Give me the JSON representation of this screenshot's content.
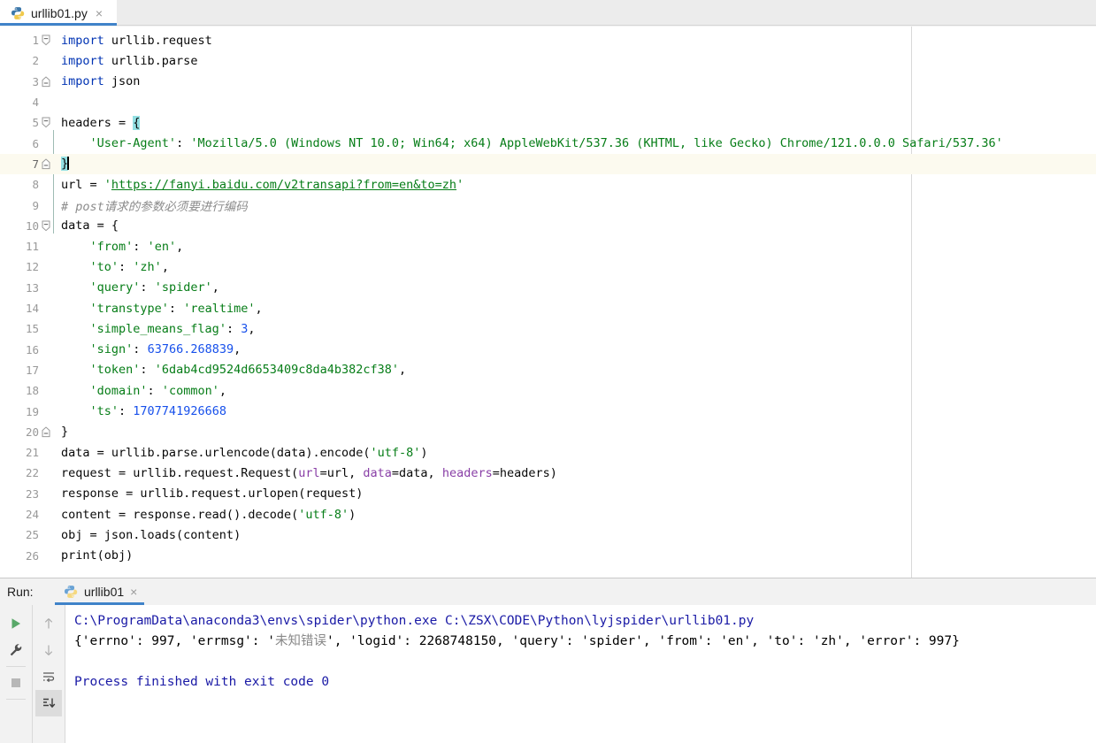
{
  "editor_tab": {
    "filename": "urllib01.py",
    "icon": "python-file-icon",
    "close_icon": "×",
    "accent_color": "#4083c9"
  },
  "code": {
    "language": "python",
    "current_line": 7,
    "lines": [
      {
        "n": 1,
        "fold": "start",
        "indent": false,
        "tokens": [
          {
            "t": "import",
            "c": "kw"
          },
          {
            "t": " urllib.request",
            "c": "plain"
          }
        ]
      },
      {
        "n": 2,
        "fold": "none",
        "indent": false,
        "tokens": [
          {
            "t": "import",
            "c": "kw"
          },
          {
            "t": " urllib.parse",
            "c": "plain"
          }
        ]
      },
      {
        "n": 3,
        "fold": "end",
        "indent": false,
        "tokens": [
          {
            "t": "import",
            "c": "kw"
          },
          {
            "t": " json",
            "c": "plain"
          }
        ]
      },
      {
        "n": 4,
        "fold": "none",
        "indent": false,
        "tokens": []
      },
      {
        "n": 5,
        "fold": "start",
        "indent": true,
        "tokens": [
          {
            "t": "headers = ",
            "c": "plain"
          },
          {
            "t": "{",
            "c": "brace-hl"
          }
        ]
      },
      {
        "n": 6,
        "fold": "none",
        "indent": true,
        "tokens": [
          {
            "t": "    ",
            "c": "plain"
          },
          {
            "t": "'User-Agent'",
            "c": "str"
          },
          {
            "t": ": ",
            "c": "plain"
          },
          {
            "t": "'Mozilla/5.0 (Windows NT 10.0; Win64; x64) AppleWebKit/537.36 (KHTML, like Gecko) Chrome/121.0.0.0 Safari/537.36'",
            "c": "str"
          }
        ]
      },
      {
        "n": 7,
        "fold": "end",
        "indent": true,
        "tokens": [
          {
            "t": "}",
            "c": "brace-hl"
          },
          {
            "t": "CARET",
            "c": "caret"
          }
        ]
      },
      {
        "n": 8,
        "fold": "none",
        "indent": false,
        "tokens": [
          {
            "t": "url = ",
            "c": "plain"
          },
          {
            "t": "'",
            "c": "str"
          },
          {
            "t": "https://fanyi.baidu.com/v2transapi?from=en&to=zh",
            "c": "url-link"
          },
          {
            "t": "'",
            "c": "str"
          }
        ]
      },
      {
        "n": 9,
        "fold": "none",
        "indent": false,
        "tokens": [
          {
            "t": "# post请求的参数必须要进行编码",
            "c": "cmt"
          }
        ]
      },
      {
        "n": 10,
        "fold": "start",
        "indent": false,
        "tokens": [
          {
            "t": "data = {",
            "c": "plain"
          }
        ]
      },
      {
        "n": 11,
        "fold": "none",
        "indent": false,
        "tokens": [
          {
            "t": "    ",
            "c": "plain"
          },
          {
            "t": "'from'",
            "c": "str"
          },
          {
            "t": ": ",
            "c": "plain"
          },
          {
            "t": "'en'",
            "c": "str"
          },
          {
            "t": ",",
            "c": "plain"
          }
        ]
      },
      {
        "n": 12,
        "fold": "none",
        "indent": false,
        "tokens": [
          {
            "t": "    ",
            "c": "plain"
          },
          {
            "t": "'to'",
            "c": "str"
          },
          {
            "t": ": ",
            "c": "plain"
          },
          {
            "t": "'zh'",
            "c": "str"
          },
          {
            "t": ",",
            "c": "plain"
          }
        ]
      },
      {
        "n": 13,
        "fold": "none",
        "indent": false,
        "tokens": [
          {
            "t": "    ",
            "c": "plain"
          },
          {
            "t": "'query'",
            "c": "str"
          },
          {
            "t": ": ",
            "c": "plain"
          },
          {
            "t": "'spider'",
            "c": "str"
          },
          {
            "t": ",",
            "c": "plain"
          }
        ]
      },
      {
        "n": 14,
        "fold": "none",
        "indent": false,
        "tokens": [
          {
            "t": "    ",
            "c": "plain"
          },
          {
            "t": "'transtype'",
            "c": "str"
          },
          {
            "t": ": ",
            "c": "plain"
          },
          {
            "t": "'realtime'",
            "c": "str"
          },
          {
            "t": ",",
            "c": "plain"
          }
        ]
      },
      {
        "n": 15,
        "fold": "none",
        "indent": false,
        "tokens": [
          {
            "t": "    ",
            "c": "plain"
          },
          {
            "t": "'simple_means_flag'",
            "c": "str"
          },
          {
            "t": ": ",
            "c": "plain"
          },
          {
            "t": "3",
            "c": "num"
          },
          {
            "t": ",",
            "c": "plain"
          }
        ]
      },
      {
        "n": 16,
        "fold": "none",
        "indent": false,
        "tokens": [
          {
            "t": "    ",
            "c": "plain"
          },
          {
            "t": "'sign'",
            "c": "str"
          },
          {
            "t": ": ",
            "c": "plain"
          },
          {
            "t": "63766.268839",
            "c": "num"
          },
          {
            "t": ",",
            "c": "plain"
          }
        ]
      },
      {
        "n": 17,
        "fold": "none",
        "indent": false,
        "tokens": [
          {
            "t": "    ",
            "c": "plain"
          },
          {
            "t": "'token'",
            "c": "str"
          },
          {
            "t": ": ",
            "c": "plain"
          },
          {
            "t": "'6dab4cd9524d6653409c8da4b382cf38'",
            "c": "str"
          },
          {
            "t": ",",
            "c": "plain"
          }
        ]
      },
      {
        "n": 18,
        "fold": "none",
        "indent": false,
        "tokens": [
          {
            "t": "    ",
            "c": "plain"
          },
          {
            "t": "'domain'",
            "c": "str"
          },
          {
            "t": ": ",
            "c": "plain"
          },
          {
            "t": "'common'",
            "c": "str"
          },
          {
            "t": ",",
            "c": "plain"
          }
        ]
      },
      {
        "n": 19,
        "fold": "none",
        "indent": false,
        "tokens": [
          {
            "t": "    ",
            "c": "plain"
          },
          {
            "t": "'ts'",
            "c": "str"
          },
          {
            "t": ": ",
            "c": "plain"
          },
          {
            "t": "1707741926668",
            "c": "num"
          }
        ]
      },
      {
        "n": 20,
        "fold": "end",
        "indent": false,
        "tokens": [
          {
            "t": "}",
            "c": "plain"
          }
        ]
      },
      {
        "n": 21,
        "fold": "none",
        "indent": false,
        "tokens": [
          {
            "t": "data = urllib.parse.urlencode(data).encode(",
            "c": "plain"
          },
          {
            "t": "'utf-8'",
            "c": "str"
          },
          {
            "t": ")",
            "c": "plain"
          }
        ]
      },
      {
        "n": 22,
        "fold": "none",
        "indent": false,
        "tokens": [
          {
            "t": "request = urllib.request.Request(",
            "c": "plain"
          },
          {
            "t": "url",
            "c": "kwarg"
          },
          {
            "t": "=url, ",
            "c": "plain"
          },
          {
            "t": "data",
            "c": "kwarg"
          },
          {
            "t": "=data, ",
            "c": "plain"
          },
          {
            "t": "headers",
            "c": "kwarg"
          },
          {
            "t": "=headers)",
            "c": "plain"
          }
        ]
      },
      {
        "n": 23,
        "fold": "none",
        "indent": false,
        "tokens": [
          {
            "t": "response = urllib.request.urlopen(request)",
            "c": "plain"
          }
        ]
      },
      {
        "n": 24,
        "fold": "none",
        "indent": false,
        "tokens": [
          {
            "t": "content = response.read().decode(",
            "c": "plain"
          },
          {
            "t": "'utf-8'",
            "c": "str"
          },
          {
            "t": ")",
            "c": "plain"
          }
        ]
      },
      {
        "n": 25,
        "fold": "none",
        "indent": false,
        "tokens": [
          {
            "t": "obj = json.loads(content)",
            "c": "plain"
          }
        ]
      },
      {
        "n": 26,
        "fold": "none",
        "indent": false,
        "tokens": [
          {
            "t": "print(obj)",
            "c": "plain"
          }
        ]
      }
    ]
  },
  "run_window": {
    "label": "Run:",
    "tab": {
      "name": "urllib01",
      "icon": "python-run-icon",
      "close_icon": "×"
    },
    "toolbar": {
      "rerun_icon": "run-play-icon",
      "settings_icon": "wrench-icon",
      "stop_icon": "stop-square-icon",
      "up_icon": "arrow-up-icon",
      "down_icon": "arrow-down-icon",
      "soft_wrap_icon": "soft-wrap-icon",
      "scroll_to_end_icon": "scroll-to-end-icon"
    },
    "console": {
      "lines": [
        {
          "id": "command-line",
          "segments": [
            {
              "t": "C:\\ProgramData\\anaconda3\\envs\\spider\\python.exe C:\\ZSX\\CODE\\Python\\lyjspider\\urllib01.py",
              "c": "c-blue"
            }
          ]
        },
        {
          "id": "output-line",
          "segments": [
            {
              "t": "{'errno': 997, 'errmsg': '",
              "c": "plain"
            },
            {
              "t": "未知错误",
              "c": "c-cn"
            },
            {
              "t": "', 'logid': 2268748150, 'query': 'spider', 'from': 'en', 'to': 'zh', 'error': 997}",
              "c": "plain"
            }
          ]
        },
        {
          "id": "blank-line",
          "segments": [
            {
              "t": " ",
              "c": "plain"
            }
          ]
        },
        {
          "id": "exit-line",
          "segments": [
            {
              "t": "Process finished with exit code 0",
              "c": "c-blue"
            }
          ]
        }
      ]
    }
  }
}
